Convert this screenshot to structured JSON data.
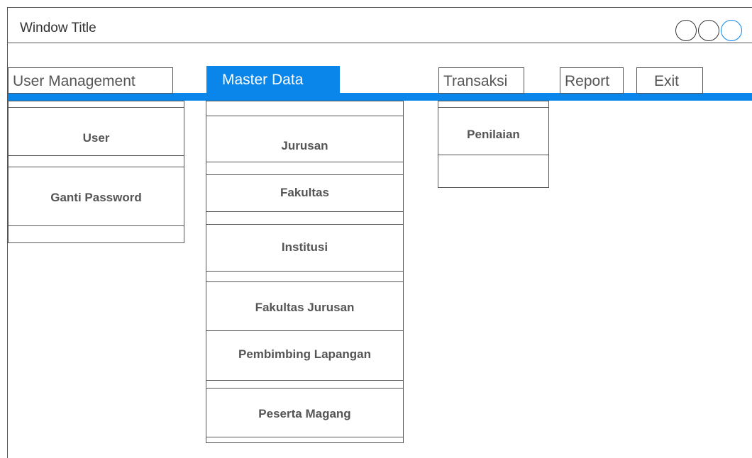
{
  "window": {
    "title": "Window Title",
    "controls": [
      "minimize-control",
      "maximize-control",
      "close-control"
    ],
    "close_control_border_color": "#0a86ea"
  },
  "accent_color": "#0a86ea",
  "menu": {
    "tabs": [
      {
        "label": "User Management"
      },
      {
        "label": "Master Data",
        "active": true
      },
      {
        "label": "Transaksi"
      },
      {
        "label": "Report"
      },
      {
        "label": "Exit"
      }
    ]
  },
  "user_management_menu": {
    "items": [
      "User",
      "Ganti Password"
    ]
  },
  "master_data_menu": {
    "items": [
      "Jurusan",
      "Fakultas",
      "Institusi",
      "Fakultas Jurusan",
      "Pembimbing Lapangan",
      "Peserta Magang"
    ]
  },
  "transaksi_menu": {
    "items": [
      "Penilaian"
    ]
  }
}
